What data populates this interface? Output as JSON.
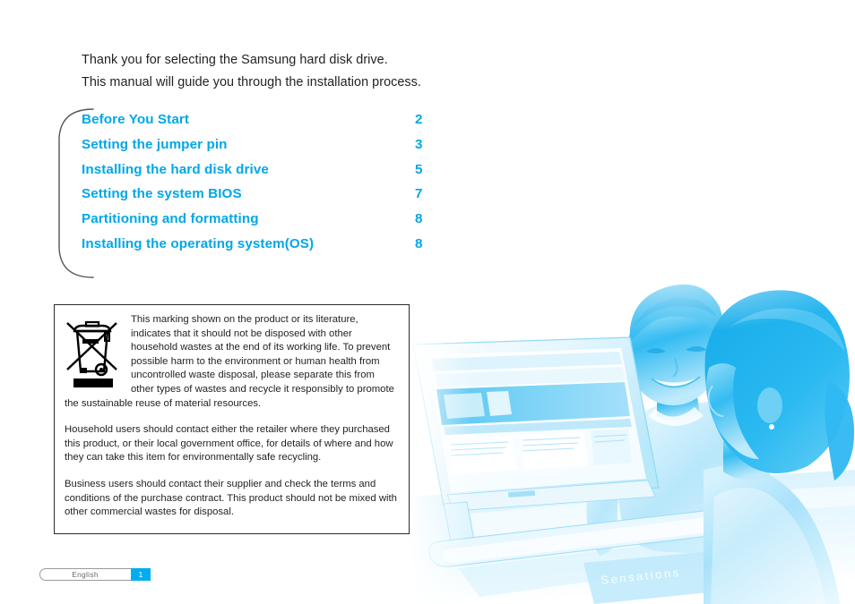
{
  "page": {
    "language": "English",
    "page_number": "1",
    "accent_color": "#00a7e7",
    "footer_badge_color": "#00aeef",
    "text_color": "#231f20"
  },
  "intro": {
    "line1": "Thank you for selecting the Samsung hard disk drive.",
    "line2": "This manual will guide you through the installation process."
  },
  "toc": {
    "items": [
      {
        "label": "Before You Start",
        "page": "2"
      },
      {
        "label": "Setting the jumper pin",
        "page": "3"
      },
      {
        "label": "Installing the hard disk drive",
        "page": "5"
      },
      {
        "label": "Setting the system BIOS",
        "page": "7"
      },
      {
        "label": "Partitioning and formatting",
        "page": "8"
      },
      {
        "label": "Installing the operating system(OS)",
        "page": "8"
      }
    ]
  },
  "weee": {
    "icon_name": "crossed-out-wheelie-bin-icon",
    "paragraph1": "This marking shown on the product or its literature, indicates that it should not be disposed with other household wastes at the end of its working life. To prevent possible harm to the environment or human health from uncontrolled waste disposal, please separate this from other types of wastes and recycle it responsibly to promote the sustainable reuse of material resources.",
    "paragraph2": "Household users should contact either the retailer where they purchased this product, or their local government office, for details of where and how they can take this item for environmentally safe recycling.",
    "paragraph3": "Business users should contact their supplier and check the terms and conditions of the purchase contract.  This product should not be mixed with other commercial wastes for disposal."
  },
  "photo": {
    "description": "Cyan duotone photograph of a smiling man leaning over a desk beside a flat-panel monitor, with a woman seen from behind in the foreground",
    "desk_object_label": "Sensations",
    "duotone_color": "#29b6f0"
  }
}
